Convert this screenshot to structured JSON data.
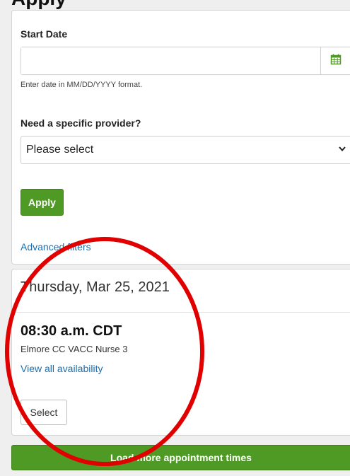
{
  "page": {
    "heading": "Apply"
  },
  "filters": {
    "start_date_label": "Start Date",
    "start_date_value": "",
    "start_date_hint": "Enter date in MM/DD/YYYY format.",
    "calendar_icon": "calendar-icon",
    "provider_label": "Need a specific provider?",
    "provider_selected": "Please select",
    "dropdown_icon": "chevron-down-icon",
    "apply_label": "Apply",
    "advanced_filters_label": "Advanced filters"
  },
  "slot": {
    "date": "Thursday, Mar 25, 2021",
    "time": "08:30 a.m. CDT",
    "provider": "Elmore CC VACC Nurse 3",
    "view_all_label": "View all availability",
    "select_label": "Select"
  },
  "load_more_label": "Load more appointment times",
  "colors": {
    "accent_green": "#4f9a25",
    "link_blue": "#1a6fb0",
    "annotation_red": "#e00000"
  }
}
